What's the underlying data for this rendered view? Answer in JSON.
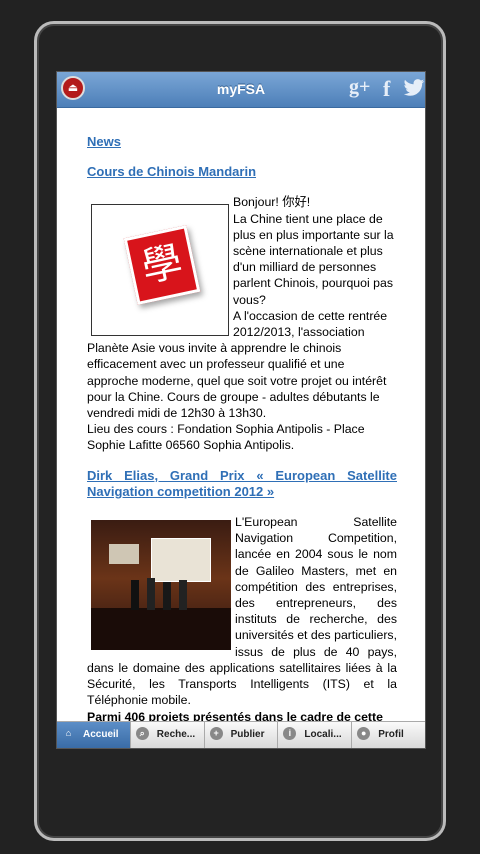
{
  "app": {
    "title": "myFSA"
  },
  "header": {
    "logout_icon": "logout-icon",
    "social": [
      "google-plus-icon",
      "facebook-icon",
      "twitter-icon"
    ]
  },
  "content": {
    "section_title": "News",
    "article1": {
      "title": "Cours de Chinois Mandarin",
      "image_icon": "chinese-character-icon",
      "image_text": "學",
      "body": "Bonjour! 你好!\nLa Chine tient une place de plus en plus importante sur la scène internationale et plus d'un milliard de personnes parlent Chinois, pourquoi pas vous?\nA l'occasion de cette rentrée 2012/2013, l'association Planète Asie vous invite à apprendre le chinois efficacement avec un professeur qualifié et une approche moderne, quel que soit votre projet ou intérêt pour la Chine. Cours de groupe - adultes débutants le vendredi midi de 12h30 à 13h30.\nLieu des cours : Fondation Sophia Antipolis - Place Sophie Lafitte 06560 Sophia Antipolis."
    },
    "article2": {
      "title": "Dirk Elias, Grand Prix « European Satellite Navigation competition 2012 »",
      "body": "L'European Satellite Navigation Competition, lancée en 2004 sous le nom de Galileo Masters, met en compétition des entreprises, des entrepreneurs, des instituts de recherche, des universités et des particuliers, issus de plus de 40 pays, dans le domaine des applications satellitaires liées à la Sécurité, les Transports Intelligents (ITS) et la Téléphonie mobile.",
      "bold_line": "Parmi 406 projets présentés dans le cadre de cette"
    }
  },
  "tabs": [
    {
      "label": "Accueil",
      "icon": "home-icon",
      "active": true
    },
    {
      "label": "Reche...",
      "icon": "search-icon",
      "active": false
    },
    {
      "label": "Publier",
      "icon": "plus-icon",
      "active": false
    },
    {
      "label": "Locali...",
      "icon": "info-icon",
      "active": false
    },
    {
      "label": "Profil",
      "icon": "user-icon",
      "active": false
    }
  ],
  "colors": {
    "link": "#2f6fb6",
    "topbar": "#5a8cc4",
    "logout": "#b31b1b"
  }
}
